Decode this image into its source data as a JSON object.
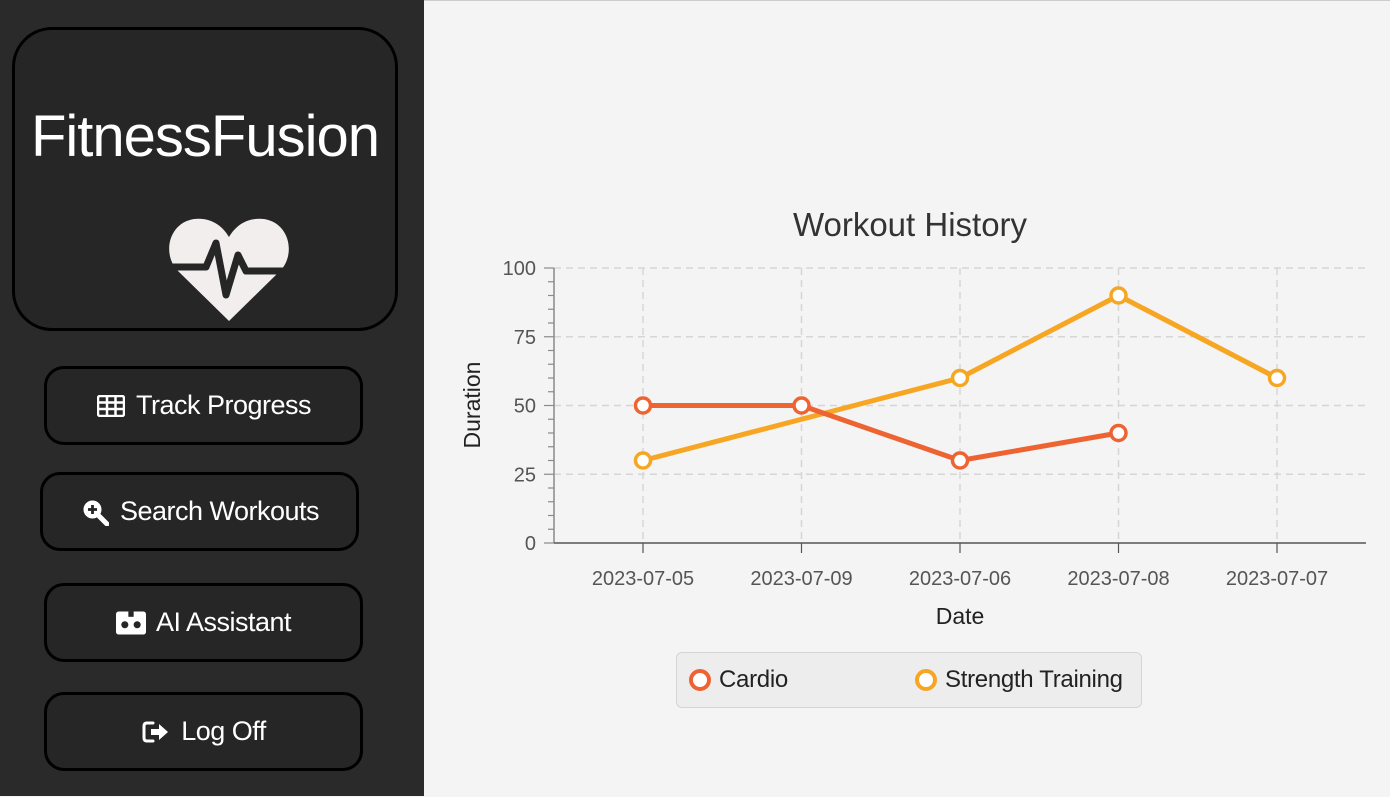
{
  "app": {
    "title": "FitnessFusion",
    "logo_icon": "heart-pulse-icon"
  },
  "sidebar": {
    "buttons": [
      {
        "label": "Track Progress",
        "icon": "table-icon"
      },
      {
        "label": "Search Workouts",
        "icon": "search-plus-icon"
      },
      {
        "label": "AI Assistant",
        "icon": "robot-icon"
      },
      {
        "label": "Log Off",
        "icon": "sign-out-icon"
      }
    ]
  },
  "colors": {
    "sidebar_bg": "#2a2a2a",
    "cardio": "#ee6332",
    "strength": "#f6a623"
  },
  "chart_data": {
    "type": "line",
    "title": "Workout History",
    "xlabel": "Date",
    "ylabel": "Duration",
    "categories": [
      "2023-07-05",
      "2023-07-09",
      "2023-07-06",
      "2023-07-08",
      "2023-07-07"
    ],
    "yticks": [
      "0",
      "25",
      "50",
      "75",
      "100"
    ],
    "ylim": [
      0,
      100
    ],
    "grid": true,
    "legend_position": "bottom",
    "series": [
      {
        "name": "Cardio",
        "values": [
          50,
          50,
          30,
          40,
          null
        ],
        "color": "#ee6332"
      },
      {
        "name": "Strength Training",
        "values": [
          30,
          null,
          60,
          90,
          60
        ],
        "color": "#f6a623"
      }
    ]
  }
}
